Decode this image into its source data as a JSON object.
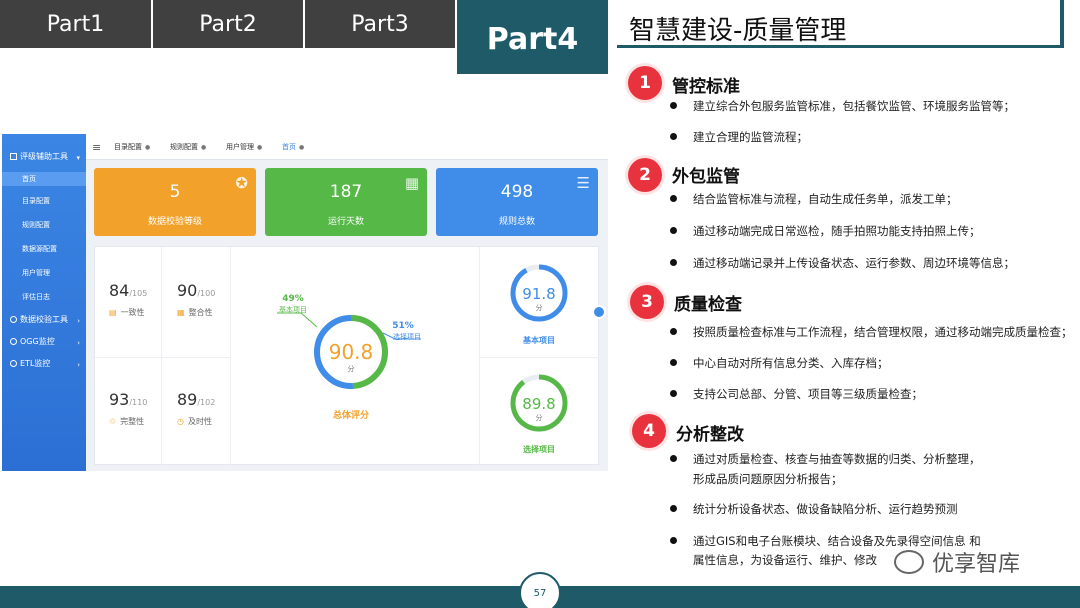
{
  "tabs": [
    "Part1",
    "Part2",
    "Part3"
  ],
  "active_tab": "Part4",
  "slide_title": "智慧建设-质量管理",
  "dashboard": {
    "sidebar": [
      {
        "label": "评级辅助工具",
        "type": "group"
      },
      {
        "label": "首页",
        "type": "sub",
        "active": true
      },
      {
        "label": "目录配置",
        "type": "sub"
      },
      {
        "label": "规则配置",
        "type": "sub"
      },
      {
        "label": "数据源配置",
        "type": "sub"
      },
      {
        "label": "用户管理",
        "type": "sub"
      },
      {
        "label": "评估日志",
        "type": "sub"
      },
      {
        "label": "数据校验工具",
        "type": "group"
      },
      {
        "label": "OGG监控",
        "type": "group"
      },
      {
        "label": "ETL监控",
        "type": "group"
      }
    ],
    "top_tabs": [
      "目录配置",
      "规则配置",
      "用户管理",
      "首页"
    ],
    "cards": [
      {
        "value": "5",
        "label": "数据校验等级",
        "color": "#f2a22a"
      },
      {
        "value": "187",
        "label": "运行天数",
        "color": "#56b847"
      },
      {
        "value": "498",
        "label": "规则总数",
        "color": "#3f8de8"
      }
    ],
    "metrics": [
      {
        "value": "84",
        "total": "/105",
        "label": "一致性",
        "icon": "▤"
      },
      {
        "value": "90",
        "total": "/100",
        "label": "整合性",
        "icon": "▦"
      },
      {
        "value": "93",
        "total": "/110",
        "label": "完整性",
        "icon": "♲"
      },
      {
        "value": "89",
        "total": "/102",
        "label": "及时性",
        "icon": "◷"
      }
    ],
    "overall": {
      "score": "90.8",
      "unit": "分",
      "label": "总体评分",
      "basic_pct": "49%",
      "basic_label": "基本项目",
      "optional_pct": "51%",
      "optional_label": "选择项目",
      "basic_fraction": 0.49
    },
    "basic": {
      "score": "91.8",
      "unit": "分",
      "label": "基本项目",
      "fraction": 0.918
    },
    "optional": {
      "score": "89.8",
      "unit": "分",
      "label": "选择项目",
      "fraction": 0.898
    }
  },
  "sections": [
    {
      "num": "1",
      "title": "管控标准",
      "bullets": [
        "建立综合外包服务监管标准，包括餐饮监管、环境服务监管等；",
        "建立合理的监管流程；"
      ]
    },
    {
      "num": "2",
      "title": "外包监管",
      "bullets": [
        "结合监管标准与流程，自动生成任务单，派发工单；",
        "通过移动端完成日常巡检，随手拍照功能支持拍照上传；",
        "通过移动端记录并上传设备状态、运行参数、周边环境等信息；"
      ]
    },
    {
      "num": "3",
      "title": "质量检查",
      "bullets": [
        "按照质量检查标准与工作流程，结合管理权限，通过移动端完成质量检查；",
        "中心自动对所有信息分类、入库存档；",
        "支持公司总部、分管、项目等三级质量检查；"
      ]
    },
    {
      "num": "4",
      "title": "分析整改",
      "bullets": [
        "通过对质量检查、核查与抽查等数据的归类、分析整理，",
        "形成品质问题原因分析报告；",
        "统计分析设备状态、做设备缺陷分析、运行趋势预测",
        "通过GIS和电子台账模块、结合设备及先录得空间信息 和",
        "属性信息，为设备运行、维护、修改"
      ]
    }
  ],
  "page_number": "57",
  "watermark": "优享智库"
}
